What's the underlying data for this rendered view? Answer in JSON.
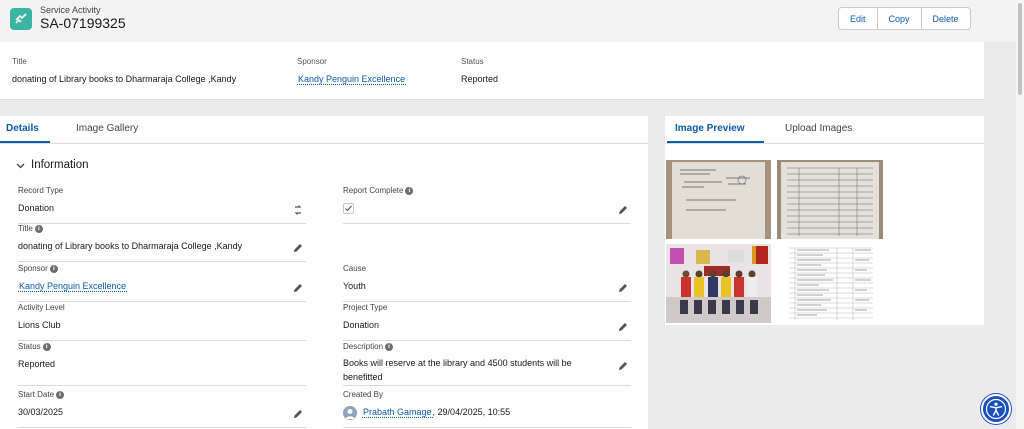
{
  "header": {
    "object_type": "Service Activity",
    "record_name": "SA-07199325",
    "actions": {
      "edit": "Edit",
      "copy": "Copy",
      "delete": "Delete"
    }
  },
  "highlights": {
    "title_label": "Title",
    "title_value": "donating of Library books to Dharmaraja College ,Kandy",
    "sponsor_label": "Sponsor",
    "sponsor_value": "Kandy Penguin Excellence",
    "status_label": "Status",
    "status_value": "Reported"
  },
  "tabs": {
    "details": "Details",
    "gallery": "Image Gallery"
  },
  "section": {
    "title": "Information"
  },
  "fields": {
    "record_type": {
      "label": "Record Type",
      "value": "Donation"
    },
    "report_complete": {
      "label": "Report Complete",
      "checked": true
    },
    "title": {
      "label": "Title",
      "value": "donating of Library books to Dharmaraja College ,Kandy"
    },
    "sponsor": {
      "label": "Sponsor",
      "value": "Kandy Penguin Excellence"
    },
    "cause": {
      "label": "Cause",
      "value": "Youth"
    },
    "activity_level": {
      "label": "Activity Level",
      "value": "Lions Club"
    },
    "project_type": {
      "label": "Project Type",
      "value": "Donation"
    },
    "status": {
      "label": "Status",
      "value": "Reported"
    },
    "description": {
      "label": "Description",
      "value": "Books will reserve at the library and 4500 students will be benefitted"
    },
    "start_date": {
      "label": "Start Date",
      "value": "30/03/2025"
    },
    "created_by": {
      "label": "Created By",
      "user": "Prabath Gamage",
      "datetime": ", 29/04/2025, 10:55"
    }
  },
  "right_tabs": {
    "preview": "Image Preview",
    "upload": "Upload Images"
  },
  "icons": {
    "app": "service-activity-icon",
    "chevron": "chevron-down-icon",
    "info": "info-icon",
    "edit": "pencil-icon",
    "change_type": "change-record-type-icon",
    "accessibility": "accessibility-icon"
  },
  "colors": {
    "accent": "#0b5cab",
    "app_icon": "#3cb4a4",
    "accessibility": "#1a4fbf"
  }
}
